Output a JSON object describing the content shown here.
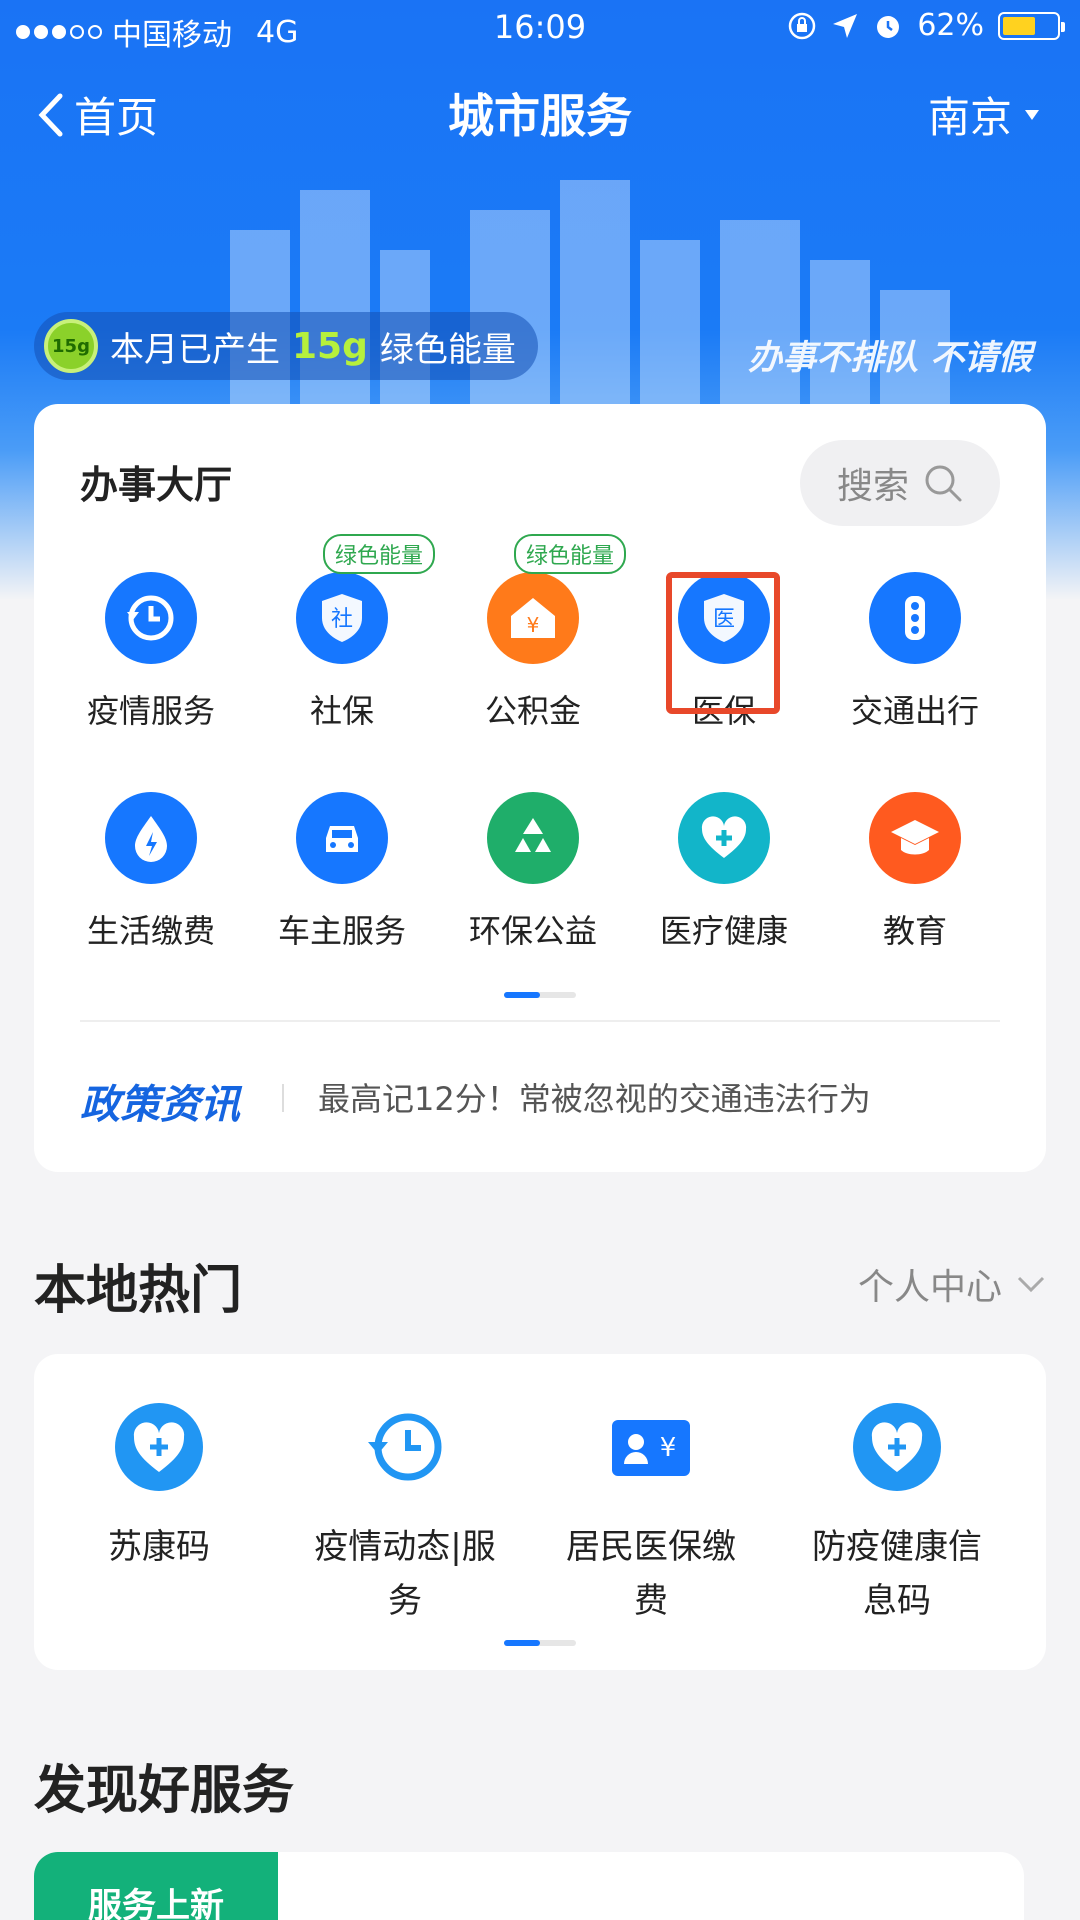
{
  "status_bar": {
    "carrier": "中国移动",
    "network": "4G",
    "time": "16:09",
    "battery": "62%",
    "battery_level": 0.62
  },
  "nav": {
    "back_label": "首页",
    "title": "城市服务",
    "city": "南京"
  },
  "banner": {
    "energy_badge": "15g",
    "energy_prefix": "本月已产生",
    "energy_value": "15g",
    "energy_suffix": "绿色能量",
    "slogan": "办事不排队 不请假"
  },
  "hall": {
    "title": "办事大厅",
    "search_label": "搜索",
    "tag_label": "绿色能量",
    "items": [
      {
        "label": "疫情服务",
        "icon": "clock-refresh-icon",
        "color": "#1677ff",
        "tag": false
      },
      {
        "label": "社保",
        "icon": "shield-she-icon",
        "color": "#1677ff",
        "tag": true
      },
      {
        "label": "公积金",
        "icon": "house-yuan-icon",
        "color": "#ff7a1a",
        "tag": true
      },
      {
        "label": "医保",
        "icon": "shield-yi-icon",
        "color": "#1677ff",
        "tag": false
      },
      {
        "label": "交通出行",
        "icon": "traffic-light-icon",
        "color": "#1677ff",
        "tag": false
      },
      {
        "label": "生活缴费",
        "icon": "water-drop-icon",
        "color": "#1677ff",
        "tag": false
      },
      {
        "label": "车主服务",
        "icon": "car-icon",
        "color": "#1677ff",
        "tag": false
      },
      {
        "label": "环保公益",
        "icon": "recycle-icon",
        "color": "#1fae6a",
        "tag": false
      },
      {
        "label": "医疗健康",
        "icon": "heart-plus-icon",
        "color": "#12b5c9",
        "tag": false
      },
      {
        "label": "教育",
        "icon": "graduation-cap-icon",
        "color": "#ff5a1f",
        "tag": false
      }
    ],
    "pager_active": 1,
    "policy_logo": "政策资讯",
    "policy_text": "最高记12分！常被忽视的交通违法行为"
  },
  "local_hot": {
    "title": "本地热门",
    "right_label": "个人中心",
    "items": [
      {
        "label": "苏康码",
        "icon": "heart-plus-icon"
      },
      {
        "label": "疫情动态|服务",
        "icon": "clock-refresh-icon"
      },
      {
        "label": "居民医保缴费",
        "icon": "id-card-yuan-icon"
      },
      {
        "label": "防疫健康信息码",
        "icon": "heart-plus-icon"
      }
    ]
  },
  "discover": {
    "title": "发现好服务",
    "new_tag": "服务上新"
  },
  "colors": {
    "primary": "#1677ff",
    "highlight": "#e8482a",
    "green": "#2fa84f"
  }
}
